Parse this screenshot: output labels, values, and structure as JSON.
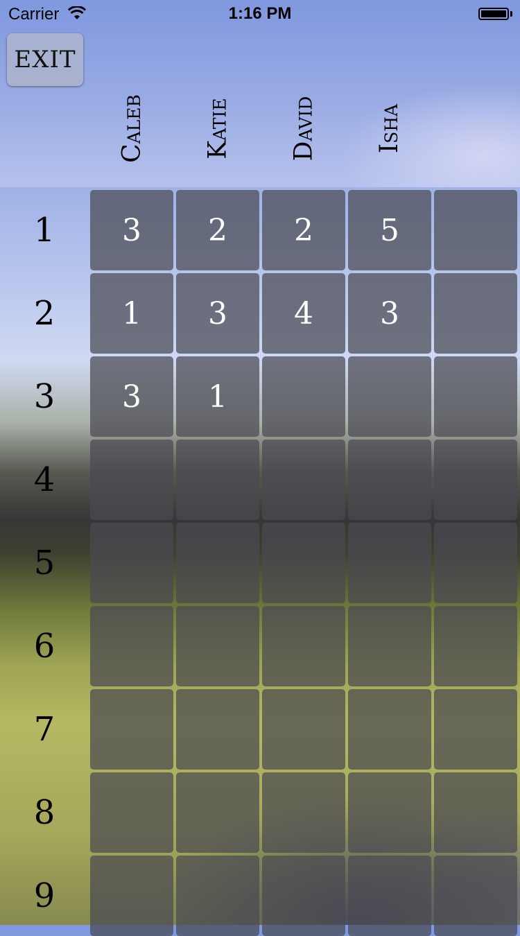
{
  "status_bar": {
    "carrier": "Carrier",
    "time": "1:16 PM"
  },
  "exit_label": "EXIT",
  "players": [
    "Caleb",
    "Katie",
    "David",
    "Isha",
    ""
  ],
  "rows": [
    {
      "label": "1",
      "scores": [
        "3",
        "2",
        "2",
        "5",
        ""
      ]
    },
    {
      "label": "2",
      "scores": [
        "1",
        "3",
        "4",
        "3",
        ""
      ]
    },
    {
      "label": "3",
      "scores": [
        "3",
        "1",
        "",
        "",
        ""
      ]
    },
    {
      "label": "4",
      "scores": [
        "",
        "",
        "",
        "",
        ""
      ]
    },
    {
      "label": "5",
      "scores": [
        "",
        "",
        "",
        "",
        ""
      ]
    },
    {
      "label": "6",
      "scores": [
        "",
        "",
        "",
        "",
        ""
      ]
    },
    {
      "label": "7",
      "scores": [
        "",
        "",
        "",
        "",
        ""
      ]
    },
    {
      "label": "8",
      "scores": [
        "",
        "",
        "",
        "",
        ""
      ]
    },
    {
      "label": "9",
      "scores": [
        "",
        "",
        "",
        "",
        ""
      ]
    }
  ],
  "colors": {
    "cell_fill": "rgba(74,74,82,0.72)",
    "score_text": "#ffffff"
  }
}
